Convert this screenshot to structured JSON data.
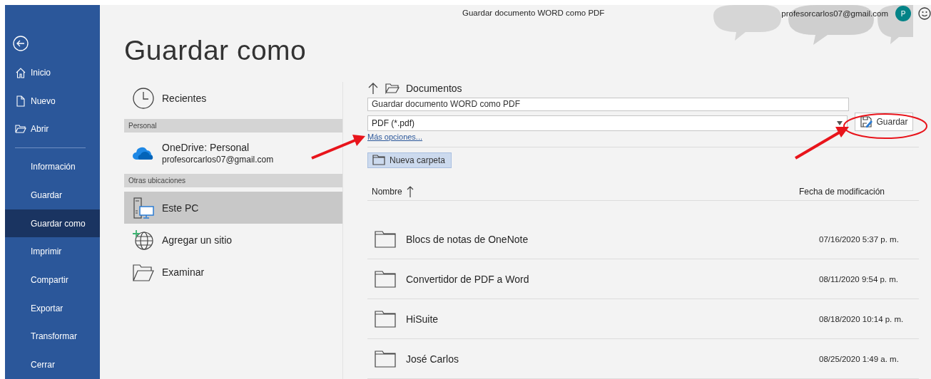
{
  "window": {
    "title": "Guardar documento WORD como PDF",
    "account": "profesorcarlos07@gmail.com",
    "avatar": "P"
  },
  "sidebar": {
    "items": [
      {
        "label": "Inicio",
        "kind": "icon",
        "selected": false
      },
      {
        "label": "Nuevo",
        "kind": "icon",
        "selected": false
      },
      {
        "label": "Abrir",
        "kind": "icon",
        "selected": false
      },
      {
        "label": "Información",
        "kind": "text",
        "selected": false
      },
      {
        "label": "Guardar",
        "kind": "text",
        "selected": false
      },
      {
        "label": "Guardar como",
        "kind": "text",
        "selected": true
      },
      {
        "label": "Imprimir",
        "kind": "text",
        "selected": false
      },
      {
        "label": "Compartir",
        "kind": "text",
        "selected": false
      },
      {
        "label": "Exportar",
        "kind": "text",
        "selected": false
      },
      {
        "label": "Transformar",
        "kind": "text",
        "selected": false
      },
      {
        "label": "Cerrar",
        "kind": "text",
        "selected": false
      }
    ]
  },
  "page_title": "Guardar como",
  "locations": [
    {
      "kind": "place",
      "label": "Recientes",
      "selected": false
    },
    {
      "kind": "header",
      "label": "Personal"
    },
    {
      "kind": "account",
      "label": "OneDrive: Personal",
      "detail": "profesorcarlos07@gmail.com",
      "selected": false
    },
    {
      "kind": "header",
      "label": "Otras ubicaciones"
    },
    {
      "kind": "place",
      "label": "Este PC",
      "selected": true
    },
    {
      "kind": "place",
      "label": "Agregar un sitio",
      "selected": false
    },
    {
      "kind": "place",
      "label": "Examinar",
      "selected": false
    }
  ],
  "save_panel": {
    "folder": "Documentos",
    "file_name": "Guardar documento WORD como PDF",
    "file_type": "PDF (*.pdf)",
    "save_button": "Guardar",
    "more_options": "Más opciones...",
    "new_folder_button": "Nueva carpeta",
    "columns": [
      "Nombre",
      "Fecha de modificación"
    ],
    "rows": [
      {
        "name": "Blocs de notas de OneNote",
        "modified": "07/16/2020 5:37 p. m."
      },
      {
        "name": "Convertidor de PDF a Word",
        "modified": "08/11/2020 9:54 p. m."
      },
      {
        "name": "HiSuite",
        "modified": "08/18/2020 10:14 p. m."
      },
      {
        "name": "José Carlos",
        "modified": "08/25/2020 1:49 a. m."
      }
    ]
  }
}
